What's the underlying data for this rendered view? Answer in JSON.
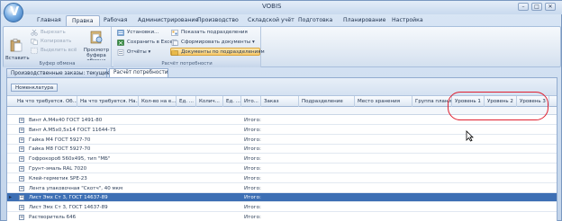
{
  "app": {
    "title": "VOBIS",
    "orb_letter": "V",
    "window_controls": [
      "–",
      "□",
      "✕"
    ]
  },
  "ribbon_tabs": [
    {
      "label": "Главная",
      "active": false
    },
    {
      "label": "Правка",
      "active": true
    },
    {
      "label": "Рабочая",
      "active": false
    },
    {
      "label": "Администрирование",
      "active": false
    },
    {
      "label": "Производство",
      "active": false
    },
    {
      "label": "Складской учёт",
      "active": false
    },
    {
      "label": "Подготовка",
      "active": false
    },
    {
      "label": "Планирование",
      "active": false
    },
    {
      "label": "Настройка",
      "active": false
    }
  ],
  "ribbon": {
    "clipboard_group": {
      "caption": "Буфер обмена",
      "paste_label": "Вставить",
      "cut_label": "Вырезать",
      "copy_label": "Копировать",
      "select_all_label": "Выделить всё",
      "preview_label_1": "Просмотр",
      "preview_label_2": "буфера обмена"
    },
    "needs_group": {
      "caption": "Расчёт потребности",
      "install_label": "Установки...",
      "save_excel_label": "Сохранить в Excel",
      "reports_label": "Отчёты",
      "show_subdivisions_label": "Показать подразделения",
      "form_documents_label": "Сформировать документы",
      "docs_by_subdivisions_label": "Документы по подразделениям"
    }
  },
  "doc_tabs": [
    {
      "label": "Производственные заказы: текущие",
      "active": false
    },
    {
      "label": "Расчёт потребности",
      "active": true
    }
  ],
  "grid": {
    "group_panel_label": "Номенклатура",
    "columns": [
      "На что требуется. Об...",
      "На что требуется. На...",
      "Кол-во на е...",
      "Ед. ...",
      "Колич...",
      "Ед. ...",
      "Ито...",
      "Заказ",
      "Подразделение",
      "Место хранения",
      "Группа планиро...",
      "Уровень 1",
      "Уровень 2",
      "Уровень 3"
    ],
    "rows": [
      {
        "name": "Винт А.М4х40 ГОСТ 1491-80",
        "total": "Итого:",
        "selected": false
      },
      {
        "name": "Винт А.М5х0,5х14 ГОСТ 11644-75",
        "total": "Итого:",
        "selected": false
      },
      {
        "name": "Гайка М4 ГОСТ 5927-70",
        "total": "Итого:",
        "selected": false
      },
      {
        "name": "Гайка М8 ГОСТ 5927-70",
        "total": "Итого:",
        "selected": false
      },
      {
        "name": "Гофрокороб 560х495, тип \"МБ\"",
        "total": "Итого:",
        "selected": false
      },
      {
        "name": "Грунт-эмаль RAL 7020",
        "total": "Итого:",
        "selected": false
      },
      {
        "name": "Клей-герметик SPE-23",
        "total": "Итого:",
        "selected": false
      },
      {
        "name": "Лента упаковочная \"Скотч\", 40 мкм",
        "total": "Итого:",
        "selected": false
      },
      {
        "name": "Лист Эмх Ст 3, ГОСТ 14637-89",
        "total": "Итого:",
        "selected": true
      },
      {
        "name": "Лист Эмх Ст 3, ГОСТ 14637-89",
        "total": "Итого:",
        "selected": false
      },
      {
        "name": "Растворитель 646",
        "total": "Итого:",
        "selected": false
      }
    ]
  },
  "colors": {
    "highlight_oval": "#e02030",
    "selected_row": "#3d6fb4"
  }
}
